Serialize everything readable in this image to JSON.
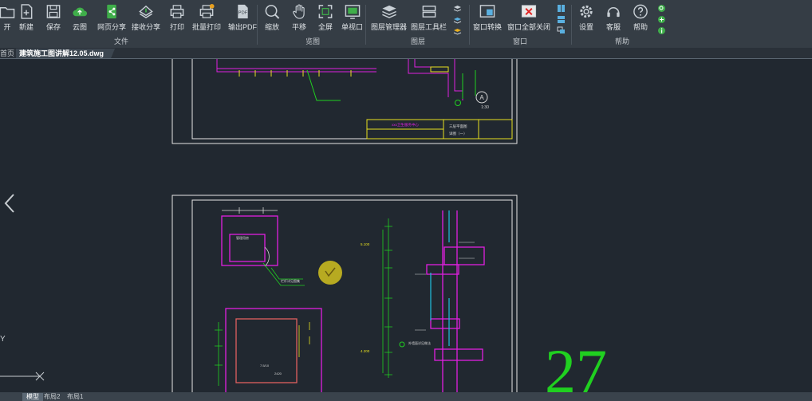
{
  "ribbon": {
    "buttons": [
      {
        "id": "open",
        "label": "开"
      },
      {
        "id": "new",
        "label": "新建"
      },
      {
        "id": "save",
        "label": "保存"
      },
      {
        "id": "cloud",
        "label": "云图"
      },
      {
        "id": "webshare",
        "label": "网页分享"
      },
      {
        "id": "recvshare",
        "label": "接收分享"
      },
      {
        "id": "print",
        "label": "打印"
      },
      {
        "id": "batchprint",
        "label": "批量打印"
      },
      {
        "id": "exportpdf",
        "label": "输出PDF"
      },
      {
        "id": "zoom",
        "label": "缩放"
      },
      {
        "id": "pan",
        "label": "平移"
      },
      {
        "id": "fullscreen",
        "label": "全屏"
      },
      {
        "id": "singleview",
        "label": "单视口"
      },
      {
        "id": "layermgr",
        "label": "图层管理器"
      },
      {
        "id": "layertoolbar",
        "label": "图层工具栏"
      },
      {
        "id": "winswitch",
        "label": "窗口转换"
      },
      {
        "id": "closeall",
        "label": "窗口全部关闭"
      },
      {
        "id": "settings",
        "label": "设置"
      },
      {
        "id": "service",
        "label": "客服"
      },
      {
        "id": "help",
        "label": "帮助"
      }
    ],
    "groups": {
      "file": "文件",
      "view": "览图",
      "layer": "图层",
      "window": "窗口",
      "help": "帮助"
    },
    "pdf_badge": "PDF"
  },
  "tabs": {
    "home": "首页",
    "file": "建筑施工图讲解12.05.dwg"
  },
  "layout_tabs": [
    "模型",
    "布局2",
    "布局1"
  ],
  "drawing": {
    "big_number": "27",
    "detail_label": "A",
    "detail_scale": "1:30",
    "title_block_text_1": "xxx卫生服务中心",
    "title_block_text_2": "三层平面图",
    "title_block_text_3": "详图（一）",
    "room_label_1": "管理用房",
    "annotation_1": "栏杆详见图集",
    "annotation_2": "外墙面详见做法",
    "elev_1": "5.100",
    "elev_2": "4.200",
    "dim_1": "7.5/10",
    "dim_2": "2420",
    "axis_label": "Y"
  },
  "colors": {
    "ribbon_bg": "#353d45",
    "canvas_bg": "#212830",
    "sheet_border": "#e6e6e6",
    "cad_magenta": "#e020e0",
    "cad_yellow": "#e8e020",
    "cad_green": "#20d020",
    "cad_cyan": "#20c0e0",
    "cad_white": "#d8d8d8"
  }
}
